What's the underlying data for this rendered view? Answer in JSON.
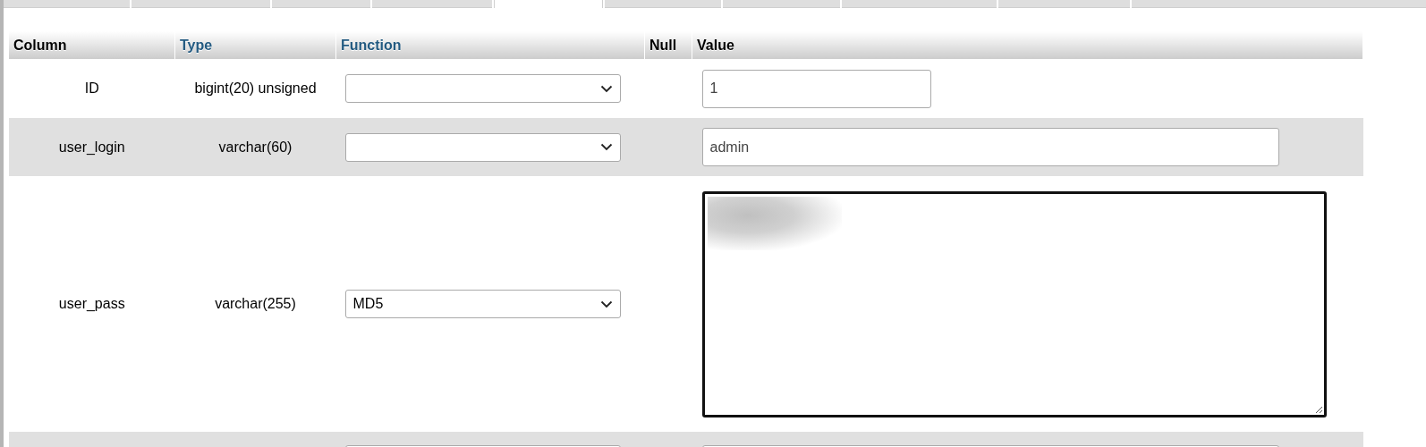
{
  "tabs": [
    {
      "selected": false
    },
    {
      "selected": false
    },
    {
      "selected": false
    },
    {
      "selected": false
    },
    {
      "selected": true
    },
    {
      "selected": false
    },
    {
      "selected": false
    },
    {
      "selected": false
    },
    {
      "selected": false
    },
    {
      "selected": false
    }
  ],
  "table": {
    "columns": [
      {
        "label": "Column",
        "link": false
      },
      {
        "label": "Type",
        "link": true
      },
      {
        "label": "Function",
        "link": true
      },
      {
        "label": "Null",
        "link": false
      },
      {
        "label": "Value",
        "link": false
      }
    ],
    "rows": [
      {
        "column": "ID",
        "type": "bigint(20) unsigned",
        "function": "",
        "value": "1",
        "kind": "short_input",
        "focused": false
      },
      {
        "column": "user_login",
        "type": "varchar(60)",
        "function": "",
        "value": "admin",
        "kind": "input",
        "focused": false
      },
      {
        "column": "user_pass",
        "type": "varchar(255)",
        "function": "MD5",
        "kind": "textarea",
        "blurred": true,
        "focused": true
      },
      {
        "kind": "cut_off"
      }
    ]
  }
}
